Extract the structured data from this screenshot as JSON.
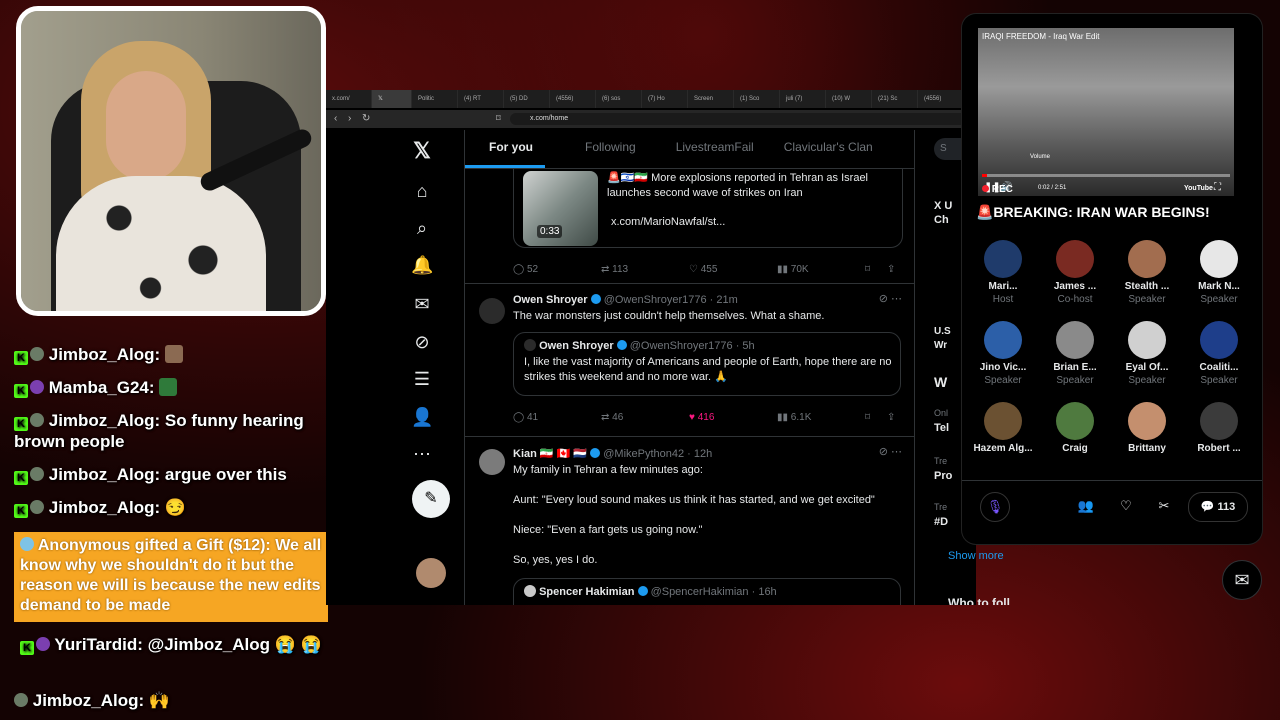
{
  "chat": {
    "lines": [
      {
        "user": "Jimboz_Alog:",
        "msg": ""
      },
      {
        "user": "Mamba_G24:",
        "msg": ""
      },
      {
        "user": "Jimboz_Alog:",
        "msg": "So funny hearing brown people"
      },
      {
        "user": "Jimboz_Alog:",
        "msg": "argue over this"
      },
      {
        "user": "Jimboz_Alog:",
        "msg": "😏"
      }
    ],
    "gift": {
      "text": "Anonymous gifted a Gift ($12): We all know why we shouldn't do it but the reason we will is because the new edits demand to be made"
    },
    "line6": {
      "user": "YuriTardid:",
      "msg": "@Jimboz_Alog 😭 😭"
    },
    "line7": {
      "user": "Jimboz_Alog:",
      "msg": "🙌"
    }
  },
  "browser": {
    "tabs": [
      "x.com/",
      "",
      "Politic",
      "(4) RT",
      "(5) DD",
      "(4556)",
      "(6) sos",
      "(7) Ho",
      "Screen",
      "(1) Sco",
      "juli (7)",
      "(10) W",
      "(21) Sc",
      "(4556)"
    ],
    "url": "x.com/home"
  },
  "x": {
    "tabs": [
      "For you",
      "Following",
      "LivestreamFail",
      "Clavicular's Clan"
    ],
    "post1": {
      "text": "🚨🇮🇱🇮🇷 More explosions reported in Tehran as Israel launches second wave of strikes on Iran",
      "link": "x.com/MarioNawfal/st...",
      "duration": "0:33",
      "replies": "52",
      "reposts": "113",
      "likes": "455",
      "views": "70K"
    },
    "post2": {
      "name": "Owen Shroyer",
      "handle": "@OwenShroyer1776 · 21m",
      "text": "The war monsters just couldn't help themselves. What a shame.",
      "quote_name": "Owen Shroyer",
      "quote_handle": "@OwenShroyer1776 · 5h",
      "quote_text": "I, like the vast majority of Americans and people of Earth, hope there are no strikes this weekend and no more war. 🙏",
      "replies": "41",
      "reposts": "46",
      "likes": "416",
      "views": "6.1K"
    },
    "post3": {
      "name": "Kian 🇮🇷 🇨🇦 🇳🇱",
      "handle": "@MikePython42 · 12h",
      "line1": "My family in Tehran a few minutes ago:",
      "line2": "Aunt: \"Every loud sound makes us think it has started, and we get excited\"",
      "line3": "Niece: \"Even a fart gets us going now.\"",
      "line4": "So, yes, yes I do.",
      "quote_name": "Spencer Hakimian",
      "quote_handle": "@SpencerHakimian · 16h"
    },
    "right": {
      "search": "S",
      "item1": "X U",
      "item1b": "Ch",
      "item2": "U.S",
      "item2b": "Wr",
      "heading": "W",
      "t1": "Onl",
      "t1b": "Tel",
      "t2": "Tre",
      "t2b": "Pro",
      "t3": "Tre",
      "t3b": "#D",
      "show_more": "Show more",
      "who": "Who to foll"
    }
  },
  "spaces": {
    "video_title": "IRAQI FREEDOM - Iraq War Edit",
    "video_time": "0:02 / 2:51",
    "video_brand": "YouTube",
    "video_label": "Volume",
    "rec": "REC",
    "title": "🚨BREAKING: IRAN WAR BEGINS!",
    "speakers": [
      {
        "name": "Mari...",
        "role": "Host"
      },
      {
        "name": "James ...",
        "role": "Co-host"
      },
      {
        "name": "Stealth ...",
        "role": "Speaker"
      },
      {
        "name": "Mark N...",
        "role": "Speaker"
      },
      {
        "name": "Jino Vic...",
        "role": "Speaker"
      },
      {
        "name": "Brian E...",
        "role": "Speaker"
      },
      {
        "name": "Eyal Of...",
        "role": "Speaker"
      },
      {
        "name": "Coaliti...",
        "role": "Speaker"
      },
      {
        "name": "Hazem Alg...",
        "role": ""
      },
      {
        "name": "Craig",
        "role": ""
      },
      {
        "name": "Brittany",
        "role": ""
      },
      {
        "name": "Robert ...",
        "role": ""
      }
    ],
    "comments": "113"
  },
  "colors": {
    "x_blue": "#1d9bf0",
    "kick_green": "#53fc18",
    "gift_orange": "#f6a623"
  }
}
